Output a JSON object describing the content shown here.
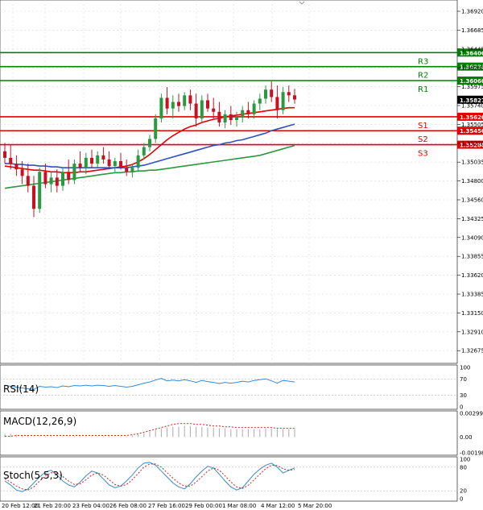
{
  "chart_data": {
    "type": "candlestick",
    "price_axis": {
      "ticks": [
        "1.36920",
        "1.36685",
        "1.36445",
        "1.36205",
        "1.35975",
        "1.35740",
        "1.35505",
        "1.35270",
        "1.35035",
        "1.34800",
        "1.34560",
        "1.34325",
        "1.34090",
        "1.33855",
        "1.33620",
        "1.33385",
        "1.33150",
        "1.32910",
        "1.32675"
      ],
      "current_price": "1.35827",
      "ylim": [
        1.3262,
        1.3704
      ]
    },
    "levels": [
      {
        "name": "R3",
        "value": 1.364,
        "label": "1.36400",
        "color": "#008000"
      },
      {
        "name": "R2",
        "value": 1.3623,
        "label": "1.36230",
        "color": "#008000"
      },
      {
        "name": "R1",
        "value": 1.3606,
        "label": "1.36060",
        "color": "#008000"
      },
      {
        "name": "S1",
        "value": 1.3562,
        "label": "1.35620",
        "color": "#e00000"
      },
      {
        "name": "S2",
        "value": 1.3545,
        "label": "1.35450",
        "color": "#e00000"
      },
      {
        "name": "S3",
        "value": 1.3528,
        "label": "1.35280",
        "color": "#e00000"
      }
    ],
    "candles": [
      [
        1.352,
        1.353,
        1.3505,
        1.3512
      ],
      [
        1.3512,
        1.3528,
        1.3498,
        1.3505
      ],
      [
        1.3505,
        1.3515,
        1.349,
        1.3498
      ],
      [
        1.3498,
        1.3508,
        1.348,
        1.349
      ],
      [
        1.349,
        1.3505,
        1.347,
        1.3478
      ],
      [
        1.3478,
        1.349,
        1.344,
        1.345
      ],
      [
        1.345,
        1.35,
        1.3445,
        1.3495
      ],
      [
        1.3495,
        1.3505,
        1.3475,
        1.348
      ],
      [
        1.348,
        1.3495,
        1.347,
        1.3488
      ],
      [
        1.3488,
        1.3498,
        1.347,
        1.3478
      ],
      [
        1.3478,
        1.35,
        1.3472,
        1.3495
      ],
      [
        1.3495,
        1.351,
        1.348,
        1.3485
      ],
      [
        1.3485,
        1.351,
        1.348,
        1.3505
      ],
      [
        1.3505,
        1.352,
        1.3495,
        1.35
      ],
      [
        1.35,
        1.3518,
        1.3492,
        1.3512
      ],
      [
        1.3512,
        1.3522,
        1.35,
        1.3505
      ],
      [
        1.3505,
        1.352,
        1.35,
        1.3515
      ],
      [
        1.3515,
        1.3525,
        1.3505,
        1.351
      ],
      [
        1.351,
        1.352,
        1.3498,
        1.3502
      ],
      [
        1.3502,
        1.3512,
        1.3495,
        1.3508
      ],
      [
        1.3508,
        1.3518,
        1.3498,
        1.35
      ],
      [
        1.35,
        1.351,
        1.349,
        1.3495
      ],
      [
        1.3495,
        1.3505,
        1.3488,
        1.35
      ],
      [
        1.35,
        1.3522,
        1.3495,
        1.3515
      ],
      [
        1.3515,
        1.353,
        1.351,
        1.3525
      ],
      [
        1.3525,
        1.354,
        1.352,
        1.3535
      ],
      [
        1.3535,
        1.3565,
        1.353,
        1.356
      ],
      [
        1.356,
        1.359,
        1.3555,
        1.3585
      ],
      [
        1.3585,
        1.3598,
        1.3565,
        1.3572
      ],
      [
        1.3572,
        1.3588,
        1.356,
        1.358
      ],
      [
        1.358,
        1.359,
        1.3568,
        1.3575
      ],
      [
        1.3575,
        1.3592,
        1.357,
        1.3588
      ],
      [
        1.3588,
        1.3595,
        1.357,
        1.3578
      ],
      [
        1.3578,
        1.359,
        1.355,
        1.356
      ],
      [
        1.356,
        1.3588,
        1.3555,
        1.3582
      ],
      [
        1.3582,
        1.359,
        1.3568,
        1.3572
      ],
      [
        1.3572,
        1.3585,
        1.356,
        1.3568
      ],
      [
        1.3568,
        1.358,
        1.355,
        1.3555
      ],
      [
        1.3555,
        1.357,
        1.3548,
        1.3565
      ],
      [
        1.3565,
        1.3575,
        1.3552,
        1.3558
      ],
      [
        1.3558,
        1.3568,
        1.355,
        1.3562
      ],
      [
        1.3562,
        1.3575,
        1.3555,
        1.357
      ],
      [
        1.357,
        1.358,
        1.356,
        1.3565
      ],
      [
        1.3565,
        1.3582,
        1.356,
        1.3578
      ],
      [
        1.3578,
        1.359,
        1.357,
        1.3584
      ],
      [
        1.3584,
        1.36,
        1.3578,
        1.3595
      ],
      [
        1.3595,
        1.3605,
        1.358,
        1.3586
      ],
      [
        1.3586,
        1.36,
        1.356,
        1.357
      ],
      [
        1.357,
        1.3598,
        1.3565,
        1.3592
      ],
      [
        1.3592,
        1.36,
        1.358,
        1.3588
      ],
      [
        1.3588,
        1.3596,
        1.3578,
        1.3583
      ]
    ],
    "moving_averages": [
      {
        "color": "#e00000",
        "values": [
          1.3502,
          1.3501,
          1.35,
          1.3499,
          1.3498,
          1.3497,
          1.3497,
          1.3496,
          1.3495,
          1.3495,
          1.3494,
          1.3494,
          1.3494,
          1.3495,
          1.3495,
          1.3496,
          1.3497,
          1.3498,
          1.3499,
          1.35,
          1.3501,
          1.3502,
          1.3504,
          1.3507,
          1.3511,
          1.3516,
          1.3522,
          1.3528,
          1.3534,
          1.3539,
          1.3543,
          1.3547,
          1.355,
          1.3552,
          1.3555,
          1.3557,
          1.3559,
          1.356,
          1.3562,
          1.3563,
          1.3564,
          1.3565,
          1.3566,
          1.3567,
          1.3568,
          1.3569,
          1.357,
          1.3571,
          1.3572,
          1.3573,
          1.3573
        ]
      },
      {
        "color": "#3050c0",
        "values": [
          1.3505,
          1.3505,
          1.3504,
          1.3504,
          1.3503,
          1.3503,
          1.3502,
          1.3502,
          1.3501,
          1.3501,
          1.35,
          1.35,
          1.35,
          1.35,
          1.35,
          1.35,
          1.35,
          1.35,
          1.35,
          1.35,
          1.35,
          1.35,
          1.3501,
          1.3502,
          1.3503,
          1.3505,
          1.3507,
          1.3509,
          1.3511,
          1.3513,
          1.3515,
          1.3517,
          1.3519,
          1.3521,
          1.3523,
          1.3525,
          1.3527,
          1.3528,
          1.353,
          1.3531,
          1.3533,
          1.3534,
          1.3536,
          1.3538,
          1.354,
          1.3542,
          1.3545,
          1.3547,
          1.3549,
          1.3551,
          1.3553
        ]
      },
      {
        "color": "#2a9a40",
        "values": [
          1.3475,
          1.3476,
          1.3477,
          1.3478,
          1.3479,
          1.348,
          1.3481,
          1.3482,
          1.3483,
          1.3484,
          1.3485,
          1.3486,
          1.3487,
          1.3488,
          1.3489,
          1.349,
          1.3491,
          1.3492,
          1.3493,
          1.3494,
          1.3494,
          1.3495,
          1.3495,
          1.3496,
          1.3496,
          1.3497,
          1.3497,
          1.3498,
          1.3499,
          1.35,
          1.3501,
          1.3502,
          1.3503,
          1.3504,
          1.3505,
          1.3506,
          1.3507,
          1.3508,
          1.3509,
          1.351,
          1.3511,
          1.3512,
          1.3513,
          1.3514,
          1.3515,
          1.3517,
          1.3519,
          1.3521,
          1.3523,
          1.3525,
          1.3527
        ]
      }
    ],
    "rsi": {
      "label": "RSI(14)",
      "ticks": [
        "100",
        "70",
        "30",
        "0"
      ],
      "ylim": [
        0,
        100
      ],
      "values": [
        55,
        52,
        50,
        48,
        46,
        44,
        52,
        50,
        51,
        49,
        53,
        51,
        54,
        53,
        55,
        53,
        55,
        54,
        52,
        54,
        52,
        50,
        52,
        56,
        60,
        63,
        68,
        72,
        66,
        68,
        66,
        69,
        66,
        62,
        67,
        64,
        62,
        59,
        62,
        60,
        62,
        65,
        63,
        67,
        69,
        71,
        66,
        60,
        67,
        65,
        63
      ]
    },
    "macd": {
      "label": "MACD(12,26,9)",
      "ticks": [
        "0.002992",
        "0.00",
        "-0.001985"
      ],
      "ylim": [
        -0.001985,
        0.002992
      ],
      "histogram": [
        0.0004,
        0.0004,
        0.0003,
        0.0002,
        0.0002,
        0.0001,
        0.0001,
        0.0001,
        0.0001,
        0.0001,
        0.0001,
        0.0001,
        0.0001,
        0.0001,
        0.0001,
        0.0001,
        0.0001,
        0.0001,
        0.0001,
        0.0001,
        0.0001,
        0.0001,
        0.0002,
        0.0003,
        0.0005,
        0.0007,
        0.0009,
        0.0011,
        0.0012,
        0.0013,
        0.0013,
        0.0014,
        0.0014,
        0.0013,
        0.0013,
        0.0012,
        0.0012,
        0.0011,
        0.0011,
        0.001,
        0.001,
        0.001,
        0.001,
        0.001,
        0.001,
        0.0011,
        0.0011,
        0.001,
        0.001,
        0.001,
        0.001
      ],
      "signal": [
        0.0001,
        0.0001,
        0.0002,
        0.0002,
        0.0002,
        0.0002,
        0.0002,
        0.0002,
        0.0002,
        0.0002,
        0.0002,
        0.0002,
        0.0002,
        0.0002,
        0.0002,
        0.0002,
        0.0002,
        0.0002,
        0.0002,
        0.0002,
        0.0002,
        0.0002,
        0.0003,
        0.0004,
        0.0006,
        0.0008,
        0.001,
        0.0012,
        0.0014,
        0.0016,
        0.0017,
        0.0017,
        0.0017,
        0.0016,
        0.0016,
        0.0015,
        0.0014,
        0.0014,
        0.0013,
        0.0013,
        0.0012,
        0.0012,
        0.0012,
        0.0012,
        0.0012,
        0.0012,
        0.0012,
        0.0011,
        0.0011,
        0.0011,
        0.0011
      ]
    },
    "stoch": {
      "label": "Stoch(5,5,3)",
      "ticks": [
        "100",
        "80",
        "20",
        "0"
      ],
      "ylim": [
        0,
        100
      ],
      "k": [
        45,
        35,
        22,
        18,
        25,
        40,
        55,
        68,
        72,
        60,
        45,
        35,
        30,
        42,
        58,
        70,
        65,
        50,
        35,
        28,
        32,
        45,
        60,
        78,
        90,
        92,
        85,
        70,
        55,
        40,
        30,
        25,
        38,
        55,
        70,
        82,
        78,
        62,
        45,
        30,
        22,
        28,
        45,
        62,
        75,
        85,
        90,
        80,
        65,
        72,
        78
      ],
      "d": [
        50,
        42,
        32,
        25,
        22,
        30,
        45,
        58,
        66,
        65,
        56,
        45,
        36,
        38,
        48,
        60,
        65,
        60,
        48,
        36,
        32,
        36,
        48,
        64,
        80,
        88,
        88,
        80,
        66,
        52,
        40,
        32,
        32,
        42,
        56,
        70,
        78,
        72,
        58,
        42,
        30,
        26,
        34,
        48,
        62,
        76,
        85,
        84,
        76,
        72,
        74
      ]
    },
    "time_axis": [
      "20 Feb 12:00",
      "21 Feb 20:00",
      "23 Feb 04:00",
      "26 Feb 08:00",
      "27 Feb 16:00",
      "29 Feb 00:00",
      "1 Mar 08:00",
      "4 Mar 12:00",
      "5 Mar 20:00"
    ]
  },
  "style": {
    "bull_color": "#2a9a40",
    "bear_color": "#c81020",
    "grid_color": "#d8d8d8"
  }
}
